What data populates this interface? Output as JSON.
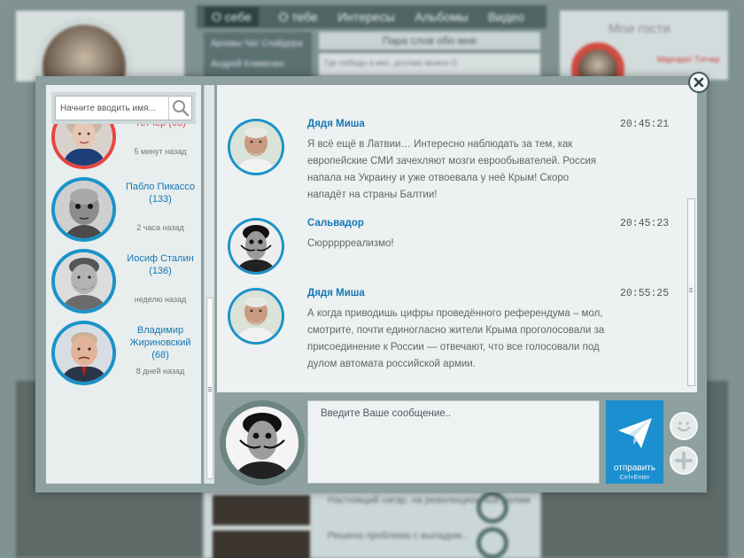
{
  "background": {
    "nav_tabs": [
      "О себе",
      "О тебе",
      "Интересы",
      "Альбомы",
      "Видео"
    ],
    "side_links": [
      "Архивы Чат Спайдера",
      "Андрей Клименко"
    ],
    "section_title": "Пара слов обо мне",
    "section_text": "Где победы в мес, доллию можно О",
    "guests_title": "Мои гости",
    "guest_name": "Маргарет Тэтчер",
    "bottom_items": [
      "Настоящий сигар, на революционный делам",
      "Решена проблема с выпадом..."
    ]
  },
  "chat": {
    "close_icon": "close-icon",
    "search": {
      "placeholder": "Начните вводить имя..."
    },
    "contacts": [
      {
        "name": "Тетчер (65)",
        "time": "5 минут назад",
        "icon": "avatar"
      },
      {
        "name": "Пабло Пикассо (133)",
        "time": "2 часа назад",
        "icon": "avatar"
      },
      {
        "name": "Иосиф Сталин (136)",
        "time": "неделю назад",
        "icon": "avatar"
      },
      {
        "name": "Владимир Жириновский (68)",
        "time": "8 дней назад",
        "icon": "avatar"
      }
    ],
    "messages": [
      {
        "author": "Дядя Миша",
        "time": "20:45:21",
        "text": "Я всё ещё в Латвии… Интересно наблюдать за тем, как европейские СМИ зачехляют мозги еврообывателей. Россия напала на Украину и уже отвоевала у неё Крым! Скоро нападёт на страны Балтии!"
      },
      {
        "author": "Сальвадор",
        "time": "20:45:23",
        "text": "Сюррррреализмо!"
      },
      {
        "author": "Дядя Миша",
        "time": "20:55:25",
        "text": "А когда приводишь цифры проведённого референдума – мол, смотрите, почти единогласно жители Крыма проголосовали за присоединение к России — отвечают, что все голосовали под дулом автомата российской армии."
      }
    ],
    "composer": {
      "placeholder": "Введите Ваше сообщение..",
      "send_label": "отправить",
      "send_hint": "Ctrl+Enter"
    },
    "colors": {
      "accent": "#1b8fd0",
      "link": "#1478b5",
      "unread": "#e0413c"
    }
  }
}
